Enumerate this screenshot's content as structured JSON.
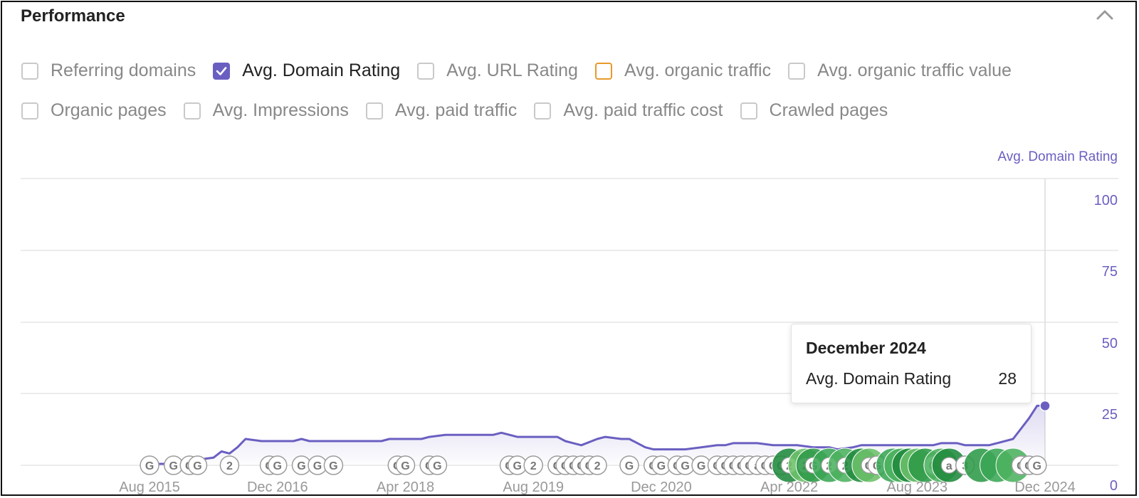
{
  "panel": {
    "title": "Performance",
    "collapse_icon": "chevron-up-icon"
  },
  "metrics_row1": [
    {
      "label": "Referring domains",
      "checked": false
    },
    {
      "label": "Avg. Domain Rating",
      "checked": true
    },
    {
      "label": "Avg. URL Rating",
      "checked": false
    },
    {
      "label": "Avg. organic traffic",
      "checked": false,
      "color": "#e89a2c"
    },
    {
      "label": "Avg. organic traffic value",
      "checked": false
    }
  ],
  "metrics_row2": [
    {
      "label": "Organic pages",
      "checked": false
    },
    {
      "label": "Avg. Impressions",
      "checked": false
    },
    {
      "label": "Avg. paid traffic",
      "checked": false
    },
    {
      "label": "Avg. paid traffic cost",
      "checked": false
    },
    {
      "label": "Crawled pages",
      "checked": false
    }
  ],
  "chart_data": {
    "type": "area",
    "ylabel": "Avg. Domain Rating",
    "ylim": [
      0,
      100
    ],
    "yticks": [
      0,
      25,
      50,
      75,
      100
    ],
    "xlim": [
      "2014-11",
      "2024-12"
    ],
    "xticks": [
      "Aug 2015",
      "Dec 2016",
      "Apr 2018",
      "Aug 2019",
      "Dec 2020",
      "Apr 2022",
      "Aug 2023",
      "Dec 2024"
    ],
    "xtick_dates": [
      "2015-08",
      "2016-12",
      "2018-04",
      "2019-08",
      "2020-12",
      "2022-04",
      "2023-08",
      "2024-12"
    ],
    "grid": true,
    "series_color": "#6a5fc1",
    "series": [
      {
        "points": [
          [
            "2015-08",
            0
          ],
          [
            "2015-10",
            0
          ],
          [
            "2015-12",
            1
          ],
          [
            "2016-02",
            2
          ],
          [
            "2016-04",
            3
          ],
          [
            "2016-05",
            6
          ],
          [
            "2016-06",
            5
          ],
          [
            "2016-07",
            8
          ],
          [
            "2016-08",
            12
          ],
          [
            "2016-10",
            11
          ],
          [
            "2016-12",
            11
          ],
          [
            "2017-02",
            11
          ],
          [
            "2017-03",
            12
          ],
          [
            "2017-04",
            11
          ],
          [
            "2017-12",
            11
          ],
          [
            "2018-01",
            11
          ],
          [
            "2018-02",
            12
          ],
          [
            "2018-06",
            12
          ],
          [
            "2018-07",
            13
          ],
          [
            "2018-09",
            14
          ],
          [
            "2019-03",
            14
          ],
          [
            "2019-04",
            15
          ],
          [
            "2019-06",
            13
          ],
          [
            "2019-07",
            13
          ],
          [
            "2019-09",
            13
          ],
          [
            "2019-11",
            13
          ],
          [
            "2019-12",
            11
          ],
          [
            "2020-01",
            10
          ],
          [
            "2020-02",
            9
          ],
          [
            "2020-04",
            12
          ],
          [
            "2020-05",
            13
          ],
          [
            "2020-07",
            12
          ],
          [
            "2020-08",
            12
          ],
          [
            "2020-10",
            8
          ],
          [
            "2020-11",
            7
          ],
          [
            "2021-01",
            7
          ],
          [
            "2021-03",
            7
          ],
          [
            "2021-05",
            8
          ],
          [
            "2021-07",
            9
          ],
          [
            "2021-08",
            9
          ],
          [
            "2021-09",
            10
          ],
          [
            "2021-12",
            10
          ],
          [
            "2022-02",
            9
          ],
          [
            "2022-05",
            9
          ],
          [
            "2022-07",
            8
          ],
          [
            "2022-09",
            8
          ],
          [
            "2022-10",
            7
          ],
          [
            "2022-12",
            8
          ],
          [
            "2023-01",
            9
          ],
          [
            "2023-03",
            9
          ],
          [
            "2023-04",
            9
          ],
          [
            "2023-06",
            9
          ],
          [
            "2023-10",
            9
          ],
          [
            "2023-11",
            10
          ],
          [
            "2024-01",
            10
          ],
          [
            "2024-02",
            9
          ],
          [
            "2024-05",
            9
          ],
          [
            "2024-06",
            10
          ],
          [
            "2024-08",
            12
          ],
          [
            "2024-09",
            17
          ],
          [
            "2024-10",
            22
          ],
          [
            "2024-11",
            28
          ],
          [
            "2024-12",
            28
          ]
        ]
      }
    ],
    "markers": [
      {
        "date": "2015-08",
        "label": "G",
        "green": false
      },
      {
        "date": "2015-11",
        "label": "G",
        "green": false
      },
      {
        "date": "2016-01",
        "label": "G",
        "green": false
      },
      {
        "date": "2016-02",
        "label": "G",
        "green": false
      },
      {
        "date": "2016-06",
        "label": "2",
        "green": false
      },
      {
        "date": "2016-11",
        "label": "G",
        "green": false
      },
      {
        "date": "2016-12",
        "label": "G",
        "green": false
      },
      {
        "date": "2017-03",
        "label": "G",
        "green": false
      },
      {
        "date": "2017-05",
        "label": "G",
        "green": false
      },
      {
        "date": "2017-07",
        "label": "G",
        "green": false
      },
      {
        "date": "2018-03",
        "label": "G",
        "green": false
      },
      {
        "date": "2018-04",
        "label": "G",
        "green": false
      },
      {
        "date": "2018-07",
        "label": "G",
        "green": false
      },
      {
        "date": "2018-08",
        "label": "G",
        "green": false
      },
      {
        "date": "2019-05",
        "label": "G",
        "green": false
      },
      {
        "date": "2019-06",
        "label": "G",
        "green": false
      },
      {
        "date": "2019-08",
        "label": "2",
        "green": false
      },
      {
        "date": "2019-11",
        "label": "G",
        "green": false
      },
      {
        "date": "2019-12",
        "label": "G",
        "green": false
      },
      {
        "date": "2020-01",
        "label": "G",
        "green": false
      },
      {
        "date": "2020-02",
        "label": "G",
        "green": false
      },
      {
        "date": "2020-03",
        "label": "G",
        "green": false
      },
      {
        "date": "2020-04",
        "label": "2",
        "green": false
      },
      {
        "date": "2020-08",
        "label": "G",
        "green": false
      },
      {
        "date": "2020-11",
        "label": "G",
        "green": false
      },
      {
        "date": "2020-12",
        "label": "G",
        "green": false
      },
      {
        "date": "2021-02",
        "label": "G",
        "green": false
      },
      {
        "date": "2021-03",
        "label": "G",
        "green": false
      },
      {
        "date": "2021-05",
        "label": "G",
        "green": false
      },
      {
        "date": "2021-07",
        "label": "G",
        "green": false
      },
      {
        "date": "2021-08",
        "label": "G",
        "green": false
      },
      {
        "date": "2021-09",
        "label": "G",
        "green": false
      },
      {
        "date": "2021-10",
        "label": "G",
        "green": false
      },
      {
        "date": "2021-11",
        "label": "G",
        "green": false
      },
      {
        "date": "2021-12",
        "label": "a",
        "green": false
      },
      {
        "date": "2022-01",
        "label": "G",
        "green": false
      },
      {
        "date": "2022-02",
        "label": "G",
        "green": false
      },
      {
        "date": "2022-03",
        "label": "G",
        "green": false
      },
      {
        "date": "2022-04",
        "label": "2",
        "green": true
      },
      {
        "date": "2022-06",
        "label": "2",
        "green": true
      },
      {
        "date": "2022-07",
        "label": "G",
        "green": true
      },
      {
        "date": "2022-09",
        "label": "2",
        "green": true
      },
      {
        "date": "2022-11",
        "label": "2",
        "green": true
      },
      {
        "date": "2023-01",
        "label": "",
        "green": true
      },
      {
        "date": "2023-02",
        "label": "G",
        "green": true
      },
      {
        "date": "2023-03",
        "label": "G",
        "green": false
      },
      {
        "date": "2023-05",
        "label": "",
        "green": true
      },
      {
        "date": "2023-06",
        "label": "",
        "green": true
      },
      {
        "date": "2023-07",
        "label": "",
        "green": true
      },
      {
        "date": "2023-08",
        "label": "",
        "green": true
      },
      {
        "date": "2023-09",
        "label": "",
        "green": true
      },
      {
        "date": "2023-10",
        "label": "G",
        "green": false
      },
      {
        "date": "2023-11",
        "label": "",
        "green": true
      },
      {
        "date": "2023-12",
        "label": "a",
        "green": true
      },
      {
        "date": "2024-02",
        "label": "3",
        "green": false
      },
      {
        "date": "2024-04",
        "label": "",
        "green": true
      },
      {
        "date": "2024-06",
        "label": "",
        "green": true
      },
      {
        "date": "2024-08",
        "label": "",
        "green": true
      },
      {
        "date": "2024-09",
        "label": "G",
        "green": false
      },
      {
        "date": "2024-10",
        "label": "G",
        "green": false
      },
      {
        "date": "2024-11",
        "label": "G",
        "green": false
      }
    ],
    "hover": {
      "date": "2024-12",
      "value": 28
    }
  },
  "tooltip": {
    "title": "December 2024",
    "metric_label": "Avg. Domain Rating",
    "value": "28"
  }
}
